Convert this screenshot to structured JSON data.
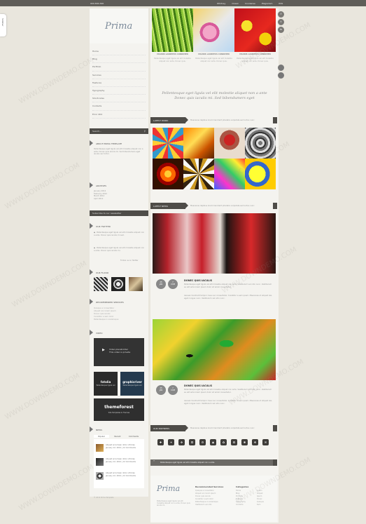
{
  "topbar": {
    "phone": "900-800-300",
    "links": [
      "Whitney",
      "Ocean",
      "Condense",
      "Plagiarism",
      "RSS"
    ]
  },
  "sidetab": "Sidebar",
  "logo": "Prima",
  "nav": [
    "Home",
    "Blog",
    "Portfolio",
    "Services",
    "Features",
    "Typography",
    "Shortcodes",
    "Contacts",
    "Error 404"
  ],
  "search": {
    "placeholder": "Search..."
  },
  "about": {
    "title": "About Prima Template",
    "text": "Pellentesque eget ligula vel elit molestie aliquet non a ante. Donec quis iaculis mi. Sed bibendumers eget iaculis nec tortor."
  },
  "archives": {
    "title": "Archives",
    "items": [
      "January 2012",
      "February 2012",
      "March 2012",
      "April 2012"
    ]
  },
  "subscribe": {
    "placeholder": "Subscribe to our newsletter"
  },
  "twitter": {
    "title": "Our Twitter",
    "tweets": [
      "Pellentesque eget ligula vel elit molestie aliquet non a ante. Donec quis iaculis mi sed.",
      "Pellentesque eget ligula vel elit molestie aliquet non a ante. Donec quis iaculis mi."
    ],
    "follow": "Follow us on Twitter"
  },
  "flickr": {
    "title": "Our Flickr"
  },
  "services": {
    "title": "Recommended Services",
    "items": [
      "Quisque a consectetur",
      "Aliquet non lorem ipsum",
      "Donec quis iaculis",
      "Curabitur a sem dolor",
      "Pellentesque in scelerisque"
    ]
  },
  "video": {
    "title": "Video",
    "label": "Video placeholder",
    "note": "This video is private"
  },
  "ads": [
    {
      "brand": "fotolia",
      "sub": "Pellentesque ligula vel"
    },
    {
      "brand": "graphicriver",
      "sub": "Pellentesque ligula vel"
    },
    {
      "brand": "themeforest",
      "sub": "Site Templates & Themes"
    }
  ],
  "news": {
    "title": "News",
    "tabs": [
      "Popular",
      "Recent",
      "Comments"
    ],
    "items": [
      {
        "title": "Aliquet accumsan dolor ultricies",
        "meta": "January 12, 2012 | 12 Comments"
      },
      {
        "title": "Aliquet accumsan dolor ultricies",
        "meta": "January 12, 2012 | 12 Comments"
      },
      {
        "title": "Aliquet accumsan dolor ultricies",
        "meta": "January 12, 2012 | 12 Comments"
      }
    ]
  },
  "copyright": "© 2012 Prima Template",
  "features": [
    {
      "label": "MAURIS LAOREEUS CONDIMEN",
      "text": "Pellentesque eget ligula vel elit molestie aliquet non ante. Donec quis."
    },
    {
      "label": "MAURIS LAOREEUS CONDIMEN",
      "text": "Pellentesque eget ligula vel elit molestie aliquet non ante. Donec quis."
    },
    {
      "label": "MAURIS LAOREEUS CONDIMEN",
      "text": "Pellentesque eget ligula vel elit molestie aliquet non ante. Donec quis."
    }
  ],
  "quote": "Pellentesque eget ligula vel elit molestie aliquet non a ante Donec quis iaculis mi. Sed bibendumers eget",
  "latest_work": {
    "label": "Latest Work",
    "desc": "Maecenas dapibus lorem hendrerit pharetra vulputate sed luctus nunc"
  },
  "latest_news": {
    "label": "Latest News",
    "desc": "Maecenas dapibus lorem hendrerit pharetra vulputate sed luctus nunc"
  },
  "posts": [
    {
      "day": "25",
      "month": "JAN",
      "comments": "7",
      "comments_label": "COM",
      "title": "Donec quis iaculis",
      "p1": "Pellentesque eget ligula vel elit molestie aliquet non ante. Vestibulum vel odio nunc. Vestibulum eu elit ante lorem ipsum dolor sit amet consectetur.",
      "p2": "Aenean hendrerit tempor risus nec consectetur. Curabitur a sem quam. Maecenas ut aliquet nisi, eget congue nunc. Vestibulum vel odio nunc."
    },
    {
      "day": "25",
      "month": "JAN",
      "comments": "7",
      "comments_label": "COM",
      "title": "Donec quis iaculis",
      "p1": "Pellentesque eget ligula vel elit molestie aliquet non ante. Vestibulum vel odio nunc. Vestibulum eu elit ante lorem ipsum dolor sit amet consectetur.",
      "p2": "Aenean hendrerit tempor risus nec consectetur. Curabitur a sem quam. Maecenas ut aliquet nisi, eget congue nunc. Vestibulum vel odio nunc."
    }
  ],
  "partners": {
    "label": "Our Partners",
    "desc": "Maecenas dapibus lorem hendrerit pharetra vulputate sed luctus nunc",
    "icons": [
      "✚",
      "✦",
      "❖",
      "✪",
      "⚙",
      "◉",
      "✿",
      "❂",
      "✱",
      "✥",
      "✉"
    ]
  },
  "banner": "Pellentesque eget ligula vel elit molestie aliquet non a ante.",
  "footer": {
    "logo": "Prima",
    "desc": "Pellentesque eget ligula vel elit molestie aliquet non a ante. Donec quis iaculis mi.",
    "col1_title": "Recommended Services",
    "col1": [
      "Quisque a consectetur",
      "Aliquet non lorem ipsum",
      "Donec quis iaculis",
      "Curabitur a sem dolor",
      "Pellentesque in scelerisque",
      "Vestibulum vel odio"
    ],
    "col2_title": "Categories",
    "col2": [
      "Home",
      "Blog",
      "Portfolio",
      "Features",
      "Typography",
      "Contacts"
    ],
    "col3": [
      "Lorem",
      "Aliquet",
      "Ipsum",
      "Donec",
      "Quisque",
      "Sem"
    ]
  },
  "social_icons": [
    "f",
    "t",
    "in"
  ],
  "watermark": "WWW.DOWNDEMO.COM"
}
